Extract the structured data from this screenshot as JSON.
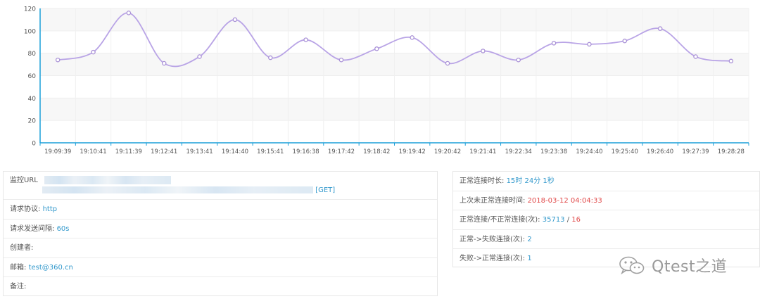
{
  "chart_data": {
    "type": "line",
    "categories": [
      "19:09:39",
      "19:10:41",
      "19:11:39",
      "19:12:41",
      "19:13:41",
      "19:14:40",
      "19:15:41",
      "19:16:38",
      "19:17:42",
      "19:18:42",
      "19:19:42",
      "19:20:42",
      "19:21:41",
      "19:22:34",
      "19:23:38",
      "19:24:40",
      "19:25:40",
      "19:26:40",
      "19:27:39",
      "19:28:28"
    ],
    "series": [
      {
        "values": [
          74,
          81,
          116,
          71,
          77,
          110,
          76,
          92,
          74,
          84,
          94,
          71,
          82,
          74,
          89,
          88,
          91,
          102,
          77,
          73
        ]
      }
    ],
    "ylim": [
      0,
      120
    ],
    "yticks": [
      0,
      20,
      40,
      60,
      80,
      100,
      120
    ],
    "grid": true,
    "line_color": "#b9a4e6",
    "axis_color": "#1a9fd9",
    "band_color": "#f7f7f7"
  },
  "info": {
    "url_label": "监控URL",
    "url_method": "[GET]",
    "protocol_label": "请求协议:",
    "protocol_value": "http",
    "interval_label": "请求发送间隔:",
    "interval_value": "60s",
    "creator_label": "创建者:",
    "email_label": "邮箱:",
    "email_value": "test@360.cn",
    "remark_label": "备注:"
  },
  "status": {
    "uptime_label": "正常连接时长:",
    "uptime_value": "15时 24分 1秒",
    "last_abnormal_label": "上次未正常连接时间:",
    "last_abnormal_value": "2018-03-12 04:04:33",
    "counts_label": "正常连接/不正常连接(次):",
    "normal_count": "35713",
    "count_sep": "/",
    "abnormal_count": "16",
    "ok_to_fail_label": "正常->失败连接(次):",
    "ok_to_fail_value": "2",
    "fail_to_ok_label": "失败->正常连接(次):",
    "fail_to_ok_value": "1"
  },
  "watermark": {
    "text": "Qtest之道",
    "icon": "wechat-icon"
  }
}
